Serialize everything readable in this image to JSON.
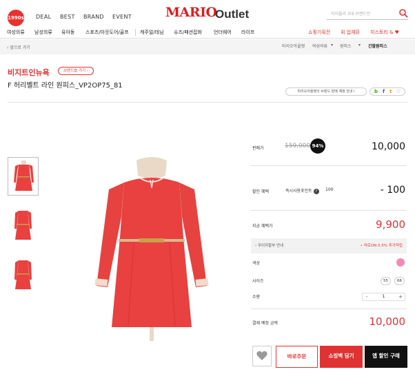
{
  "header": {
    "logo_text": "1990s",
    "nav": [
      "DEAL",
      "BEST",
      "BRAND",
      "EVENT"
    ],
    "brand_main": "MARIO",
    "brand_sub": "Outlet",
    "search_placeholder": "아이올리 3대 브랜드전"
  },
  "categories": {
    "left": [
      "여성의류",
      "남성의류",
      "유아동",
      "스포츠/아웃도어/골프",
      "캐주얼/데님",
      "슈즈/패션잡화",
      "언더웨어",
      "라이프"
    ],
    "right": [
      "쇼핑기획전",
      "위 업체뮤",
      "히스토리 & ♥"
    ]
  },
  "breadcrumb": {
    "back": "앞으로 가기",
    "items": [
      "마리오아울렛",
      "여성의류",
      "원피스",
      "긴팔원피스"
    ]
  },
  "product": {
    "store": "비지트인뉴욕",
    "store_button": "브랜드숍 가기 ›",
    "name": "F 허리벨트 라인 원피스_VP2OP75_81",
    "notice": "마리오아울렛의 브랜드 판매 예정 안내",
    "share_icons": [
      "b",
      "f",
      "t",
      "♡"
    ]
  },
  "pricing": {
    "sale_label": "판매가",
    "original_price": "159,000",
    "discount_badge": "94%",
    "sale_price": "10,000",
    "discount_label": "할인 혜택",
    "instant_discount_label": "즉시사용포인트",
    "instant_discount_value": "100",
    "discount_amount": "- 100",
    "final_label": "지금 혜택가",
    "final_price": "9,900",
    "points_note": "무이자할부 안내",
    "points_right": "• 마로ON 0.5% 추가적립",
    "color_label": "색상",
    "size_label": "사이즈",
    "sizes": [
      "55",
      "66"
    ],
    "qty_label": "수량",
    "qty_minus": "-",
    "qty_value": "1",
    "qty_plus": "+",
    "total_label": "결제 예정 금액",
    "total_price": "10,000"
  },
  "actions": {
    "order": "바로주문",
    "cart": "쇼핑백 담기",
    "buy": "앱 할인 구매"
  },
  "colors": {
    "accent": "#e03232",
    "dress": "#e8413f",
    "swatch": "#f28bb6"
  }
}
